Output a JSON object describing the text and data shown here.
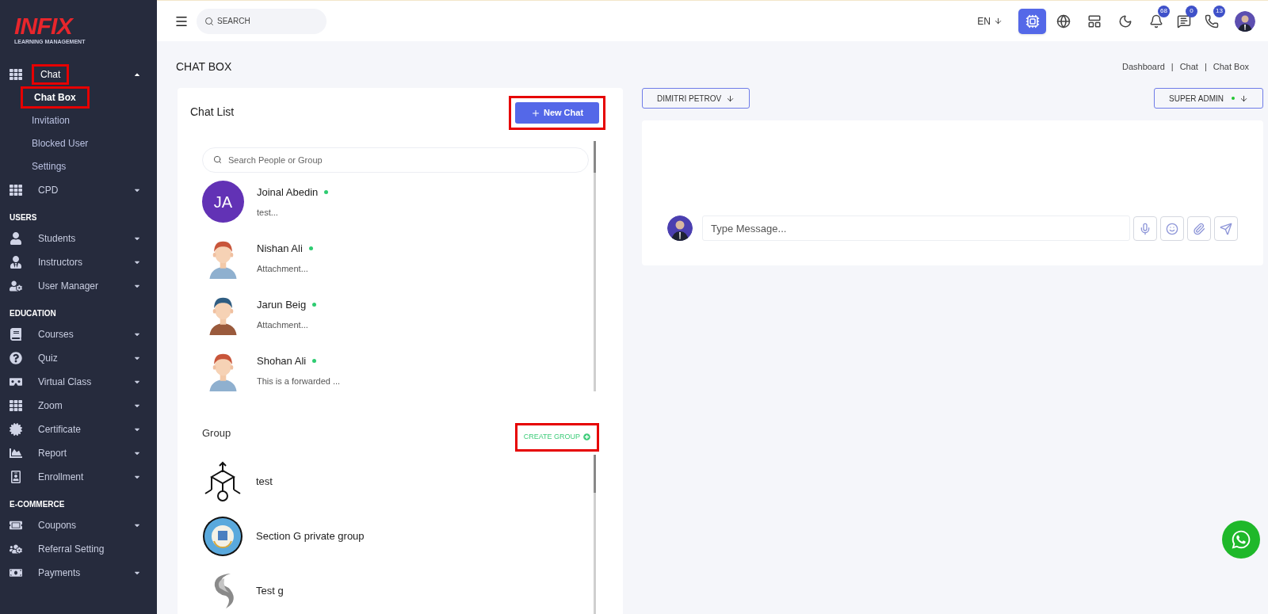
{
  "sidebar": {
    "logo": {
      "title": "INFIX",
      "subtitle": "LEARNING MANAGEMENT"
    },
    "sections": [
      {
        "items": [
          {
            "label": "Chat",
            "kind": "group",
            "expanded": true,
            "highlighted": true,
            "children": [
              {
                "label": "Chat Box",
                "selected": true,
                "highlighted": true
              },
              {
                "label": "Invitation",
                "selected": false,
                "highlighted": false
              },
              {
                "label": "Blocked User",
                "selected": false,
                "highlighted": false
              },
              {
                "label": "Settings",
                "selected": false,
                "highlighted": false
              }
            ]
          },
          {
            "label": "CPD",
            "kind": "group",
            "expanded": false,
            "highlighted": false
          }
        ]
      },
      {
        "heading": "USERS",
        "items": [
          {
            "label": "Students",
            "kind": "group",
            "expanded": false,
            "highlighted": false
          },
          {
            "label": "Instructors",
            "kind": "group",
            "expanded": false,
            "highlighted": false
          },
          {
            "label": "User Manager",
            "kind": "group",
            "expanded": false,
            "highlighted": false
          }
        ]
      },
      {
        "heading": "EDUCATION",
        "items": [
          {
            "label": "Courses",
            "kind": "group",
            "expanded": false,
            "highlighted": false
          },
          {
            "label": "Quiz",
            "kind": "group",
            "expanded": false,
            "highlighted": false
          },
          {
            "label": "Virtual Class",
            "kind": "group",
            "expanded": false,
            "highlighted": false
          },
          {
            "label": "Zoom",
            "kind": "group",
            "expanded": false,
            "highlighted": false
          },
          {
            "label": "Certificate",
            "kind": "group",
            "expanded": false,
            "highlighted": false
          },
          {
            "label": "Report",
            "kind": "group",
            "expanded": false,
            "highlighted": false
          },
          {
            "label": "Enrollment",
            "kind": "group",
            "expanded": false,
            "highlighted": false
          }
        ]
      },
      {
        "heading": "E-COMMERCE",
        "items": [
          {
            "label": "Coupons",
            "kind": "group",
            "expanded": false,
            "highlighted": false
          },
          {
            "label": "Referral Setting",
            "kind": "link",
            "expanded": false,
            "highlighted": false
          },
          {
            "label": "Payments",
            "kind": "group",
            "expanded": false,
            "highlighted": false
          }
        ]
      }
    ]
  },
  "header": {
    "search": {
      "placeholder": "SEARCH"
    },
    "language": "EN",
    "tools": [
      {
        "selected": true
      },
      {
        "selected": false
      },
      {
        "selected": false
      },
      {
        "selected": false
      }
    ],
    "notifications": [
      {
        "count": "68"
      },
      {
        "count": "0"
      },
      {
        "count": "13"
      }
    ]
  },
  "page": {
    "title": "CHAT BOX",
    "breadcrumb": [
      "Dashboard",
      "|",
      "Chat",
      "|",
      "Chat Box"
    ]
  },
  "chat_list": {
    "title": "Chat List",
    "new_chat": {
      "label": "New Chat",
      "highlighted": true
    },
    "search": {
      "placeholder": "Search People or Group"
    },
    "contacts": [
      {
        "name": "Joinal Abedin",
        "preview": "test...",
        "online": true,
        "avatar": {
          "kind": "initials",
          "initials": "JA"
        }
      },
      {
        "name": "Nishan Ali",
        "preview": "Attachment...",
        "online": true
      },
      {
        "name": "Jarun Beig",
        "preview": "Attachment...",
        "online": true
      },
      {
        "name": "Shohan Ali",
        "preview": "This is a forwarded ...",
        "online": true
      }
    ],
    "group_heading": "Group",
    "create_group": {
      "label": "CREATE GROUP",
      "highlighted": true
    },
    "groups": [
      {
        "name": "test"
      },
      {
        "name": "Section G private group"
      },
      {
        "name": "Test g"
      }
    ]
  },
  "conversation": {
    "partner": "DIMITRI PETROV",
    "user": {
      "name": "SUPER ADMIN",
      "online": true
    },
    "message": {
      "placeholder": "Type Message..."
    }
  }
}
